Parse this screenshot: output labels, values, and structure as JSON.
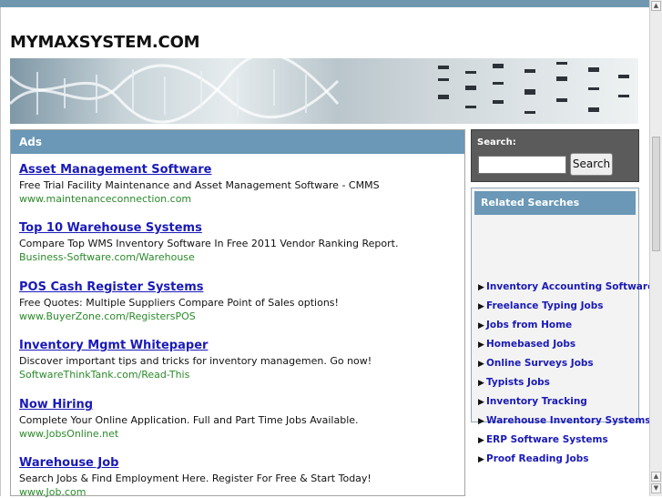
{
  "site": {
    "title": "MYMAXSYSTEM.COM"
  },
  "ads": {
    "header": "Ads",
    "items": [
      {
        "title": "Asset Management Software",
        "desc": "Free Trial Facility Maintenance and Asset Management Software - CMMS",
        "url": "www.maintenanceconnection.com"
      },
      {
        "title": "Top 10 Warehouse Systems",
        "desc": "Compare Top WMS Inventory Software In Free 2011 Vendor Ranking Report.",
        "url": "Business-Software.com/Warehouse"
      },
      {
        "title": "POS Cash Register Systems",
        "desc": "Free Quotes: Multiple Suppliers Compare Point of Sales options!",
        "url": "www.BuyerZone.com/RegistersPOS"
      },
      {
        "title": "Inventory Mgmt Whitepaper",
        "desc": "Discover important tips and tricks for inventory managemen. Go now!",
        "url": "SoftwareThinkTank.com/Read-This"
      },
      {
        "title": "Now Hiring",
        "desc": "Complete Your Online Application. Full and Part Time Jobs Available.",
        "url": "www.JobsOnline.net"
      },
      {
        "title": "Warehouse Job",
        "desc": "Search Jobs & Find Employment Here. Register For Free & Start Today!",
        "url": "www.Job.com"
      }
    ]
  },
  "search": {
    "label": "Search:",
    "button": "Search",
    "value": ""
  },
  "related": {
    "header": "Related Searches",
    "items": [
      "Inventory Accounting Software",
      "Freelance Typing Jobs",
      "Jobs from Home",
      "Homebased Jobs",
      "Online Surveys Jobs",
      "Typists Jobs",
      "Inventory Tracking",
      "Warehouse Inventory Systems",
      "ERP Software Systems",
      "Proof Reading Jobs"
    ]
  }
}
